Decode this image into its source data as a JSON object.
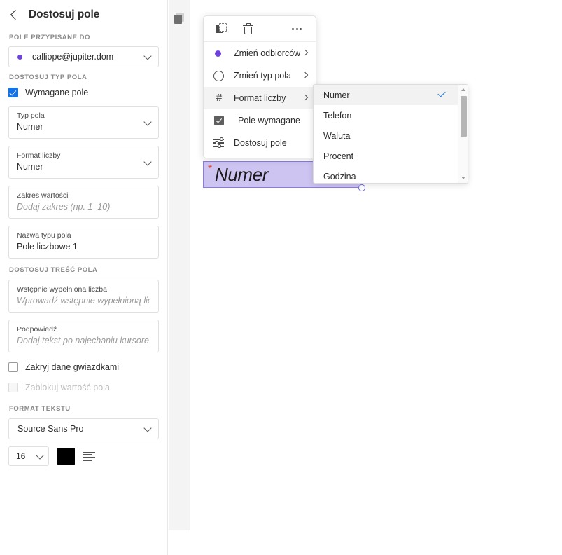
{
  "panel": {
    "title": "Dostosuj pole",
    "back_icon": "chevron-left-icon",
    "sections": {
      "assigned_to_label": "POLE PRZYPISANE DO",
      "assigned_to_value": "calliope@jupiter.dom",
      "field_type_label": "DOSTOSUJ TYP POLA",
      "content_label": "DOSTOSUJ TREŚĆ POLA",
      "text_format_label": "FORMAT TEKSTU"
    },
    "required_checkbox": {
      "label": "Wymagane pole",
      "checked": true
    },
    "fields": [
      {
        "label": "Typ pola",
        "value": "Numer",
        "type": "select"
      },
      {
        "label": "Format liczby",
        "value": "Numer",
        "type": "select"
      },
      {
        "label": "Zakres wartości",
        "placeholder": "Dodaj zakres (np. 1–10)",
        "type": "text"
      },
      {
        "label": "Nazwa typu pola",
        "value": "Pole liczbowe 1",
        "type": "text"
      },
      {
        "label": "Wstępnie wypełniona liczba",
        "placeholder": "Wprowadź wstępnie wypełnioną lic…",
        "type": "text"
      },
      {
        "label": "Podpowiedź",
        "placeholder": "Dodaj tekst po najechaniu kursore…",
        "type": "text"
      }
    ],
    "checkboxes": [
      {
        "label": "Zakryj dane gwiazdkami",
        "checked": false,
        "disabled": false
      },
      {
        "label": "Zablokuj wartość pola",
        "checked": false,
        "disabled": true
      }
    ],
    "text_format": {
      "font_family": "Source Sans Pro",
      "font_size": "16",
      "color": "#000000",
      "align_icon": "text-align-icon"
    }
  },
  "rail": {
    "pages_icon": "pages-icon"
  },
  "context_menu": {
    "toolbar": [
      {
        "name": "duplicate-icon",
        "label": "duplicate"
      },
      {
        "name": "trash-icon",
        "label": "delete"
      },
      {
        "name": "more-options-icon",
        "label": "more"
      }
    ],
    "items": [
      {
        "label": "Zmień odbiorców",
        "icon": "recipient-dot-icon",
        "submenu": true,
        "active": false
      },
      {
        "label": "Zmień typ pola",
        "icon": "sync-icon",
        "submenu": true,
        "active": false
      },
      {
        "label": "Format liczby",
        "icon": "hash-icon",
        "submenu": true,
        "active": true
      },
      {
        "label": "Pole wymagane",
        "icon": "checkbox-checked-icon",
        "submenu": false,
        "active": false
      },
      {
        "label": "Dostosuj pole",
        "icon": "sliders-icon",
        "submenu": false,
        "active": false
      }
    ]
  },
  "submenu": {
    "options": [
      {
        "label": "Numer",
        "selected": true
      },
      {
        "label": "Telefon",
        "selected": false
      },
      {
        "label": "Waluta",
        "selected": false
      },
      {
        "label": "Procent",
        "selected": false
      },
      {
        "label": "Godzina",
        "selected": false
      }
    ],
    "scrollbar": {
      "up_icon": "scroll-up-icon",
      "down_icon": "scroll-down-icon"
    }
  },
  "document_field": {
    "required_marker": "*",
    "text": "Numer",
    "fill_color": "#cdc4f1",
    "border_color": "#8b7be0"
  },
  "colors": {
    "accent_purple": "#6f42e0",
    "accent_blue": "#1473e6",
    "required_red": "#e8452c"
  }
}
